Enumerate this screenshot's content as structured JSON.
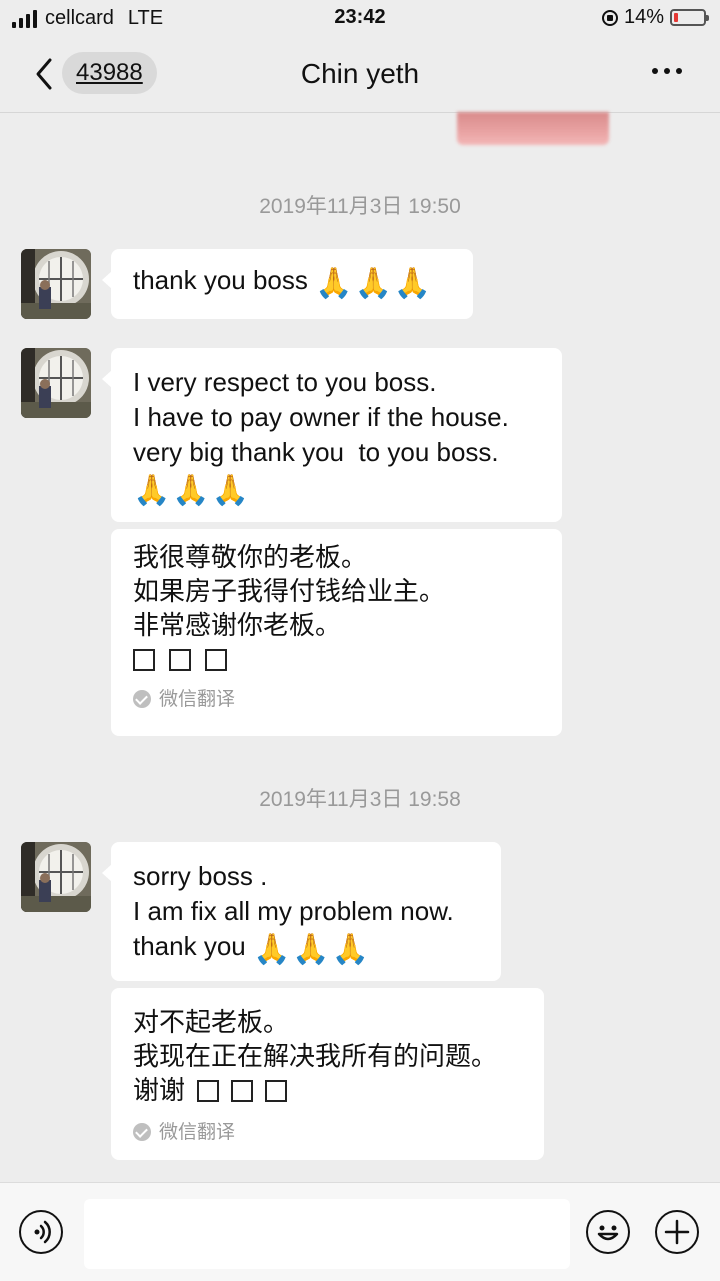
{
  "status_bar": {
    "carrier": "cellcard",
    "network": "LTE",
    "time": "23:42",
    "battery_percent": "14%",
    "battery_level": 0.14,
    "battery_color": "#e53935"
  },
  "nav": {
    "back_label": "43988",
    "title": "Chin yeth"
  },
  "messages": [
    {
      "timestamp": "2019年11月3日 19:50",
      "bubbles": [
        {
          "lines": [
            "thank you boss"
          ],
          "emoji": "🙏🙏🙏"
        },
        {
          "lines": [
            "I very respect to you boss.",
            "I have to pay owner if the house.",
            "very big thank you  to you boss."
          ],
          "emoji": "🙏🙏🙏"
        }
      ],
      "translation": {
        "lines": [
          "我很尊敬你的老板。",
          "如果房子我得付钱给业主。",
          "非常感谢你老板。"
        ],
        "label": "微信翻译"
      }
    },
    {
      "timestamp": "2019年11月3日 19:58",
      "bubbles": [
        {
          "lines": [
            "sorry boss .",
            "I am fix all my problem now.",
            "thank you"
          ],
          "emoji": "🙏🙏🙏"
        }
      ],
      "translation": {
        "lines": [
          "对不起老板。",
          "我现在正在解决我所有的问题。",
          "谢谢"
        ],
        "label": "微信翻译"
      }
    }
  ],
  "icons": {
    "back": "chevron-left-icon",
    "more": "more-dots-icon",
    "voice": "voice-icon",
    "emoji": "emoji-icon",
    "plus": "plus-icon",
    "translate_badge": "check-circle-icon"
  }
}
